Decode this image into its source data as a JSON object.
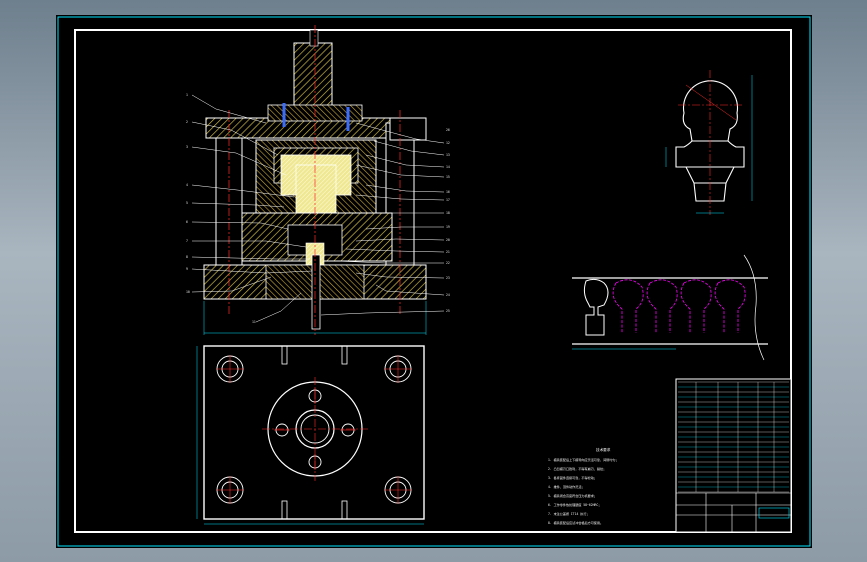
{
  "drawing": {
    "sheet_background": "#000000",
    "border_color": "#ffffff",
    "accent_cyan": "#00e5ff",
    "hatch_color": "#d8c24a",
    "centerline_color": "#ff2a2a",
    "blank_outline_color": "#ff00ff",
    "part_labels_left": [
      "1",
      "2",
      "3",
      "4",
      "5",
      "6",
      "7",
      "8",
      "9",
      "10",
      "11"
    ],
    "part_labels_right": [
      "12",
      "13",
      "14",
      "15",
      "16",
      "17",
      "18",
      "19",
      "20",
      "21",
      "22",
      "23",
      "24",
      "25",
      "26"
    ],
    "tech_notes_title": "技术要求",
    "tech_notes": [
      "1. 模具装配后上下模导向应灵活可靠，间隙均匀；",
      "2. 凸凹模刃口锋利，不得有崩刃、裂纹；",
      "3. 各紧固件连接可靠，不得松动；",
      "4. 推件、顶件动作灵活；",
      "5. 模具闭合高度符合压力机要求；",
      "6. 工作零件热处理硬度 58~62HRC；",
      "7. 未注公差按 IT14 执行；",
      "8. 模具装配后应试冲合格后方可使用。"
    ]
  }
}
